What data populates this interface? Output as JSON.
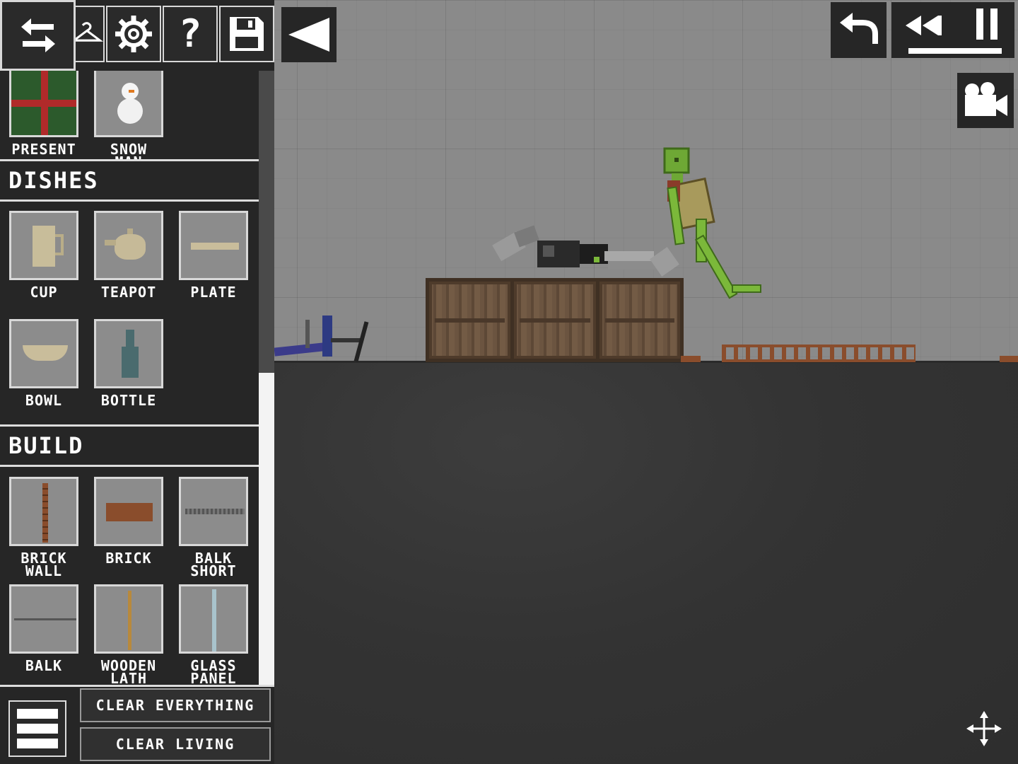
{
  "toolbar": {
    "buttons": [
      {
        "icon": "swap-arrows-icon"
      },
      {
        "icon": "hanger-icon"
      },
      {
        "icon": "gear-icon"
      },
      {
        "icon": "question-icon",
        "glyph": "?"
      },
      {
        "icon": "save-icon"
      }
    ],
    "collapse_icon": "collapse-triangle-icon"
  },
  "categories": [
    {
      "name": "",
      "items": [
        {
          "label": "PRESENT",
          "icon": "present-icon"
        },
        {
          "label": "SNOW\nMAN",
          "icon": "snowman-icon"
        }
      ]
    },
    {
      "name": "DISHES",
      "items": [
        {
          "label": "CUP",
          "icon": "cup-icon"
        },
        {
          "label": "TEAPOT",
          "icon": "teapot-icon"
        },
        {
          "label": "PLATE",
          "icon": "plate-icon"
        },
        {
          "label": "BOWL",
          "icon": "bowl-icon"
        },
        {
          "label": "BOTTLE",
          "icon": "bottle-icon"
        }
      ]
    },
    {
      "name": "BUILD",
      "items": [
        {
          "label": "BRICK\nWALL",
          "icon": "brick-wall-icon"
        },
        {
          "label": "BRICK",
          "icon": "brick-icon"
        },
        {
          "label": "BALK\nSHORT",
          "icon": "balk-short-icon"
        },
        {
          "label": "BALK",
          "icon": "balk-icon"
        },
        {
          "label": "WOODEN\nLATH",
          "icon": "wooden-lath-icon"
        },
        {
          "label": "GLASS\nPANEL",
          "icon": "glass-panel-icon"
        }
      ]
    }
  ],
  "bottom": {
    "clear_everything": "CLEAR EVERYTHING",
    "clear_living": "CLEAR LIVING"
  },
  "controls": {
    "undo_icon": "undo-icon",
    "rewind_icon": "rewind-icon",
    "pause_icon": "pause-icon",
    "camera_icon": "camera-icon",
    "move_icon": "move-arrows-icon"
  },
  "colors": {
    "panel_bg": "#262626",
    "sky": "#8a8a8a",
    "ground": "#333333",
    "wood": "#6b5440",
    "melon_green": "#7bb83a",
    "brick": "#8a4d2c"
  }
}
